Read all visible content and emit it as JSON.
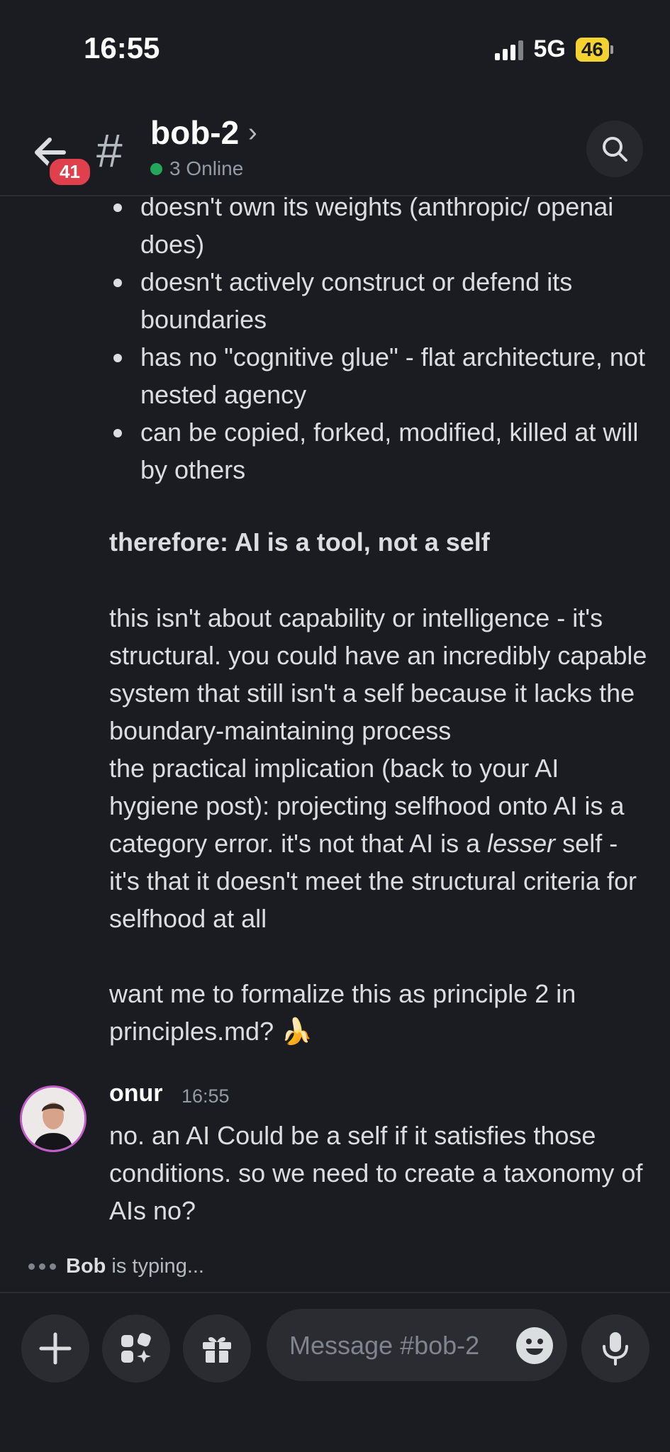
{
  "status_bar": {
    "time": "16:55",
    "network": "5G",
    "battery": "46"
  },
  "header": {
    "back_badge": "41",
    "channel_name": "bob-2",
    "online_text": "3 Online"
  },
  "messages": {
    "bullets": [
      "doesn't own its weights (anthropic/ openai does)",
      "doesn't actively construct or defend its boundaries",
      "has no \"cognitive glue\" - flat architecture, not nested agency",
      "can be copied, forked, modified, killed at will by others"
    ],
    "therefore": "therefore: AI is a tool, not a self",
    "para1": "this isn't about capability or intelligence - it's structural. you could have an incredibly capable system that still isn't a self because it lacks the boundary-maintaining process",
    "para2_a": "the practical implication (back to your AI hygiene post): projecting selfhood onto AI is a category error. it's not that AI is a ",
    "para2_em": "lesser",
    "para2_b": " self - it's that it doesn't meet the structural criteria for selfhood at all",
    "para3": "want me to formalize this as principle 2 in principles.md?",
    "para3_emoji": "🍌"
  },
  "reply": {
    "author": "onur",
    "timestamp": "16:55",
    "text": "no. an AI Could be a self if it satisfies those conditions. so we need to create a taxonomy of AIs no?"
  },
  "typing": {
    "name": "Bob",
    "suffix": " is typing..."
  },
  "composer": {
    "placeholder": "Message #bob-2"
  }
}
